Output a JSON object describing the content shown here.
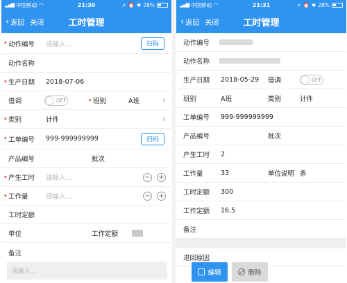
{
  "status": {
    "carrier": "中国移动",
    "left_time": "21:30",
    "right_time": "21:31",
    "battery": "28%"
  },
  "nav": {
    "back": "返回",
    "close": "关闭",
    "title": "工时管理"
  },
  "left": {
    "action_no_label": "动作编号",
    "action_no_placeholder": "请输入...",
    "scan_label": "扫码",
    "action_name_label": "动作名称",
    "prod_date_label": "生产日期",
    "prod_date_value": "2018-07-06",
    "borrow_label": "借调",
    "toggle_text": "OFF",
    "shift_label": "班别",
    "shift_value": "A班",
    "category_label": "类别",
    "category_value": "计件",
    "order_no_label": "工单编号",
    "order_no_value": "999-999999999",
    "product_no_label": "产品编号",
    "batch_label": "批次",
    "work_hours_label": "产生工时",
    "work_hours_placeholder": "请输入...",
    "workload_label": "工作量",
    "workload_placeholder": "请输入...",
    "quota_label": "工时定额",
    "unit_label": "单位",
    "quota2_label": "工作定额",
    "remark_label": "备注",
    "remark_placeholder": "请输入...",
    "minus": "−",
    "plus": "+"
  },
  "right": {
    "action_no_label": "动作编号",
    "action_name_label": "动作名称",
    "prod_date_label": "生产日期",
    "prod_date_value": "2018-05-29",
    "borrow_label": "借调",
    "toggle_text": "OFF",
    "shift_label": "班别",
    "shift_value": "A班",
    "category_label": "类别",
    "category_value": "计件",
    "order_no_label": "工单编号",
    "order_no_value": "999-999999999",
    "product_no_label": "产品编号",
    "batch_label": "批次",
    "work_hours_label": "产生工时",
    "work_hours_value": "2",
    "workload_label": "工作量",
    "workload_value": "33",
    "unit_desc_label": "单位说明",
    "unit_desc_value": "条",
    "quota_label": "工时定额",
    "quota_value": "300",
    "work_quota_label": "工作定额",
    "work_quota_value": "16.5",
    "remark_label": "备注",
    "return_reason_label": "退回原因",
    "edit_label": "编辑",
    "delete_label": "删除"
  },
  "colors": {
    "accent": "#2f93f0",
    "required": "#e53935"
  }
}
